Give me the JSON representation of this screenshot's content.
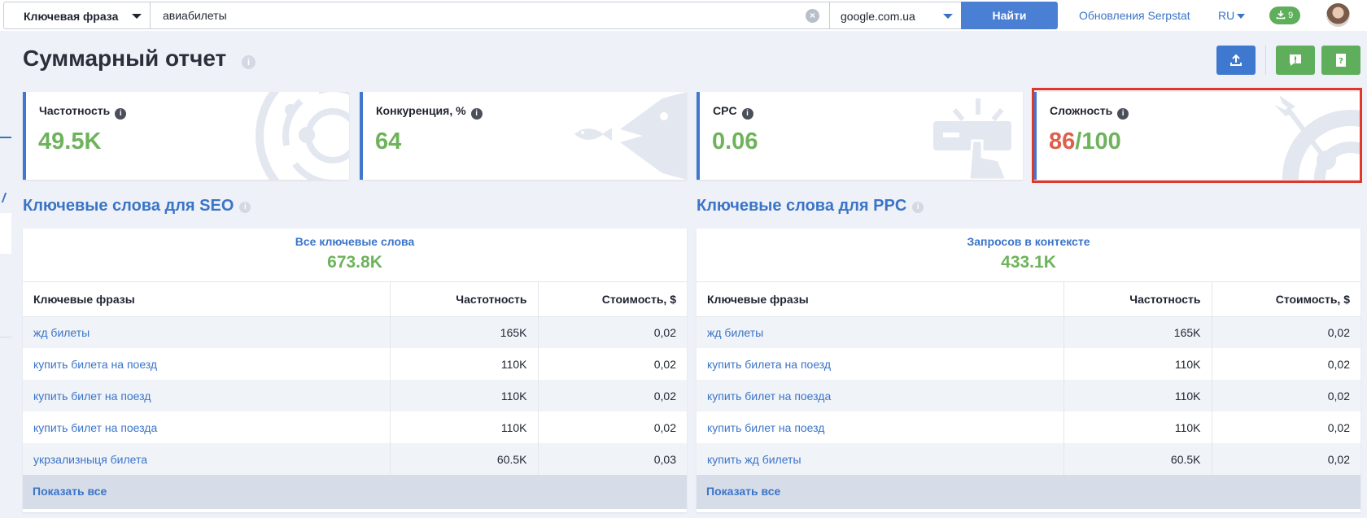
{
  "topbar": {
    "search_type": "Ключевая фраза",
    "search_value": "авиабилеты",
    "database": "google.com.ua",
    "find_label": "Найти",
    "updates_link": "Обновления Serpstat",
    "language": "RU",
    "downloads_count": "9"
  },
  "page": {
    "title": "Суммарный отчет"
  },
  "kpis": [
    {
      "label": "Частотность",
      "value": "49.5K",
      "icon": "radar-icon"
    },
    {
      "label": "Конкуренция, %",
      "value": "64",
      "icon": "big-fish-eats-small-fish-icon"
    },
    {
      "label": "CPC",
      "value": "0.06",
      "icon": "click-hand-icon"
    },
    {
      "label": "Сложность",
      "value_main": "86",
      "value_suffix": "/100",
      "icon": "target-arrow-icon"
    }
  ],
  "seo": {
    "title": "Ключевые слова для SEO",
    "summary_label": "Все ключевые слова",
    "summary_value": "673.8K",
    "columns": [
      "Ключевые фразы",
      "Частотность",
      "Стоимость, $"
    ],
    "rows": [
      {
        "phrase": "жд билеты",
        "freq": "165K",
        "cost": "0,02"
      },
      {
        "phrase": "купить билета на поезд",
        "freq": "110K",
        "cost": "0,02"
      },
      {
        "phrase": "купить билет на поезд",
        "freq": "110K",
        "cost": "0,02"
      },
      {
        "phrase": "купить билет на поезда",
        "freq": "110K",
        "cost": "0,02"
      },
      {
        "phrase": "укрзализныця билета",
        "freq": "60.5K",
        "cost": "0,03"
      }
    ],
    "show_all": "Показать все"
  },
  "ppc": {
    "title": "Ключевые слова для PPC",
    "summary_label": "Запросов в контексте",
    "summary_value": "433.1K",
    "columns": [
      "Ключевые фразы",
      "Частотность",
      "Стоимость, $"
    ],
    "rows": [
      {
        "phrase": "жд билеты",
        "freq": "165K",
        "cost": "0,02"
      },
      {
        "phrase": "купить билета на поезд",
        "freq": "110K",
        "cost": "0,02"
      },
      {
        "phrase": "купить билет на поезда",
        "freq": "110K",
        "cost": "0,02"
      },
      {
        "phrase": "купить билет на поезд",
        "freq": "110K",
        "cost": "0,02"
      },
      {
        "phrase": "купить жд билеты",
        "freq": "60.5K",
        "cost": "0,02"
      }
    ],
    "show_all": "Показать все"
  },
  "colors": {
    "accent_blue": "#3a74c8",
    "value_green": "#6eb35c",
    "difficulty_red": "#dd5f4c",
    "highlight_border": "#e0372a"
  }
}
